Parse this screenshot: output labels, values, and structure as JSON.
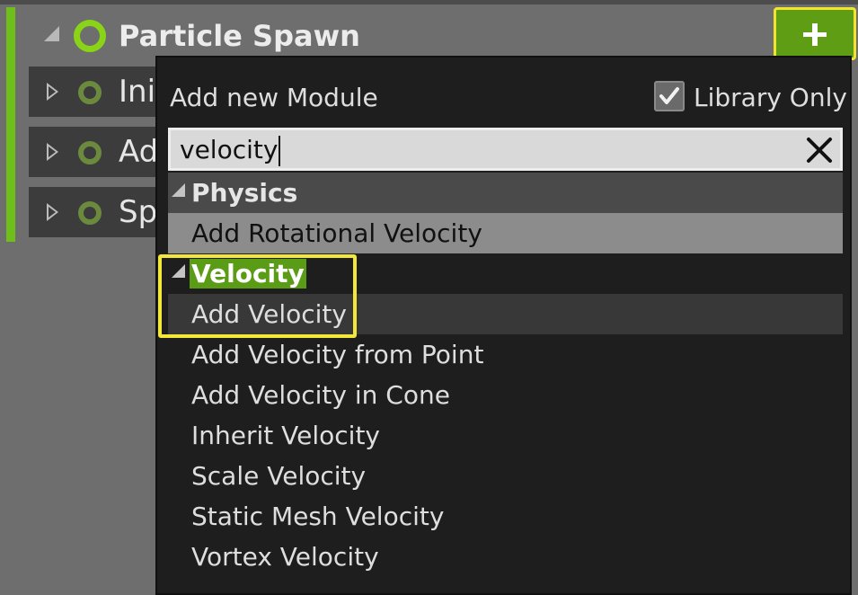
{
  "emitter": {
    "title": "Particle Spawn",
    "add_button_icon": "plus-icon",
    "modules": [
      {
        "label": "Ini"
      },
      {
        "label": "Ad"
      },
      {
        "label": "Sp"
      }
    ]
  },
  "popup": {
    "heading": "Add new Module",
    "library_only_label": "Library Only",
    "library_only_checked": true,
    "search_value": "velocity",
    "groups": [
      {
        "name": "Physics",
        "items": [
          "Add Rotational Velocity"
        ]
      },
      {
        "name": "Velocity",
        "items": [
          "Add Velocity",
          "Add Velocity from Point",
          "Add Velocity in Cone",
          "Inherit Velocity",
          "Scale Velocity",
          "Static Mesh Velocity",
          "Vortex Velocity"
        ]
      }
    ]
  },
  "colors": {
    "accent_green": "#6fbf1a",
    "highlight_yellow": "#f3e83a",
    "popup_bg": "#1e1e1e"
  }
}
